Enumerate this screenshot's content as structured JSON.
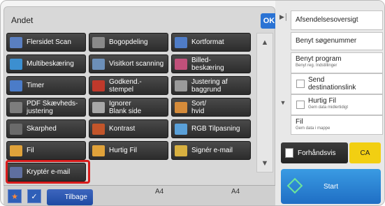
{
  "panel": {
    "title": "Andet",
    "ok_label": "OK"
  },
  "buttons": [
    {
      "label": "Flersidet Scan",
      "icon": "multipage-scan-icon",
      "icon_color": "#5a7fc0"
    },
    {
      "label": "Bogopdeling",
      "icon": "book-divide-icon",
      "icon_color": "#8a8a8a"
    },
    {
      "label": "Kortformat",
      "icon": "card-format-icon",
      "icon_color": "#4f7cc6"
    },
    {
      "label": "Multibeskæring",
      "icon": "multi-crop-icon",
      "icon_color": "#3c8fd0"
    },
    {
      "label": "Visitkort scanning",
      "icon": "business-card-icon",
      "icon_color": "#6c8fb8"
    },
    {
      "label": "Billed-\nbeskæring",
      "icon": "image-crop-icon",
      "icon_color": "#c0507a"
    },
    {
      "label": "Timer",
      "icon": "timer-icon",
      "icon_color": "#4b7cc8"
    },
    {
      "label": "Godkend.-\nstempel",
      "icon": "stamp-icon",
      "icon_color": "#c0392b"
    },
    {
      "label": "Justering af\nbaggrund",
      "icon": "background-adjust-icon",
      "icon_color": "#9a9a9a"
    },
    {
      "label": "PDF Skævheds-\njustering",
      "icon": "pdf-skew-icon",
      "icon_color": "#7d7d7d"
    },
    {
      "label": "Ignorer\nBlank side",
      "icon": "blank-page-icon",
      "icon_color": "#a8a8a8"
    },
    {
      "label": "Sort/\nhvid",
      "icon": "black-white-icon",
      "icon_color": "#d58b3a"
    },
    {
      "label": "Skarphed",
      "icon": "sharpness-icon",
      "icon_color": "#6a6a6a"
    },
    {
      "label": "Kontrast",
      "icon": "contrast-icon",
      "icon_color": "#c2552a"
    },
    {
      "label": "RGB Tilpasning",
      "icon": "rgb-adjust-icon",
      "icon_color": "#5aa0d8"
    },
    {
      "label": "Fil",
      "icon": "folder-icon",
      "icon_color": "#e0a23a"
    },
    {
      "label": "Hurtig Fil",
      "icon": "quick-file-icon",
      "icon_color": "#e0a23a"
    },
    {
      "label": "Signér e-mail",
      "icon": "sign-email-icon",
      "icon_color": "#d8b040"
    },
    {
      "label": "Kryptér e-mail",
      "icon": "encrypt-email-icon",
      "icon_color": "#5f6fa0"
    }
  ],
  "bottom": {
    "back_label": "Tilbage",
    "paper_left": "A4",
    "paper_right": "A4"
  },
  "right": {
    "history": "Afsendelsesoversigt",
    "search": "Benyt søgenummer",
    "program": "Benyt program",
    "program_sub": "Benyt reg. Indstillinger",
    "send_link": "Send\ndestinationslink",
    "quick_file": "Hurtig Fil",
    "quick_file_sub": "Gem data midlertidigt",
    "file": "Fil",
    "file_sub": "Gem data i mappe",
    "preview": "Forhåndsvis",
    "ca": "CA",
    "start": "Start"
  },
  "colors": {
    "highlight": "#d81b1b",
    "accent": "#2a73d4",
    "ca": "#f2cf12",
    "start": "#1f6ec4"
  }
}
